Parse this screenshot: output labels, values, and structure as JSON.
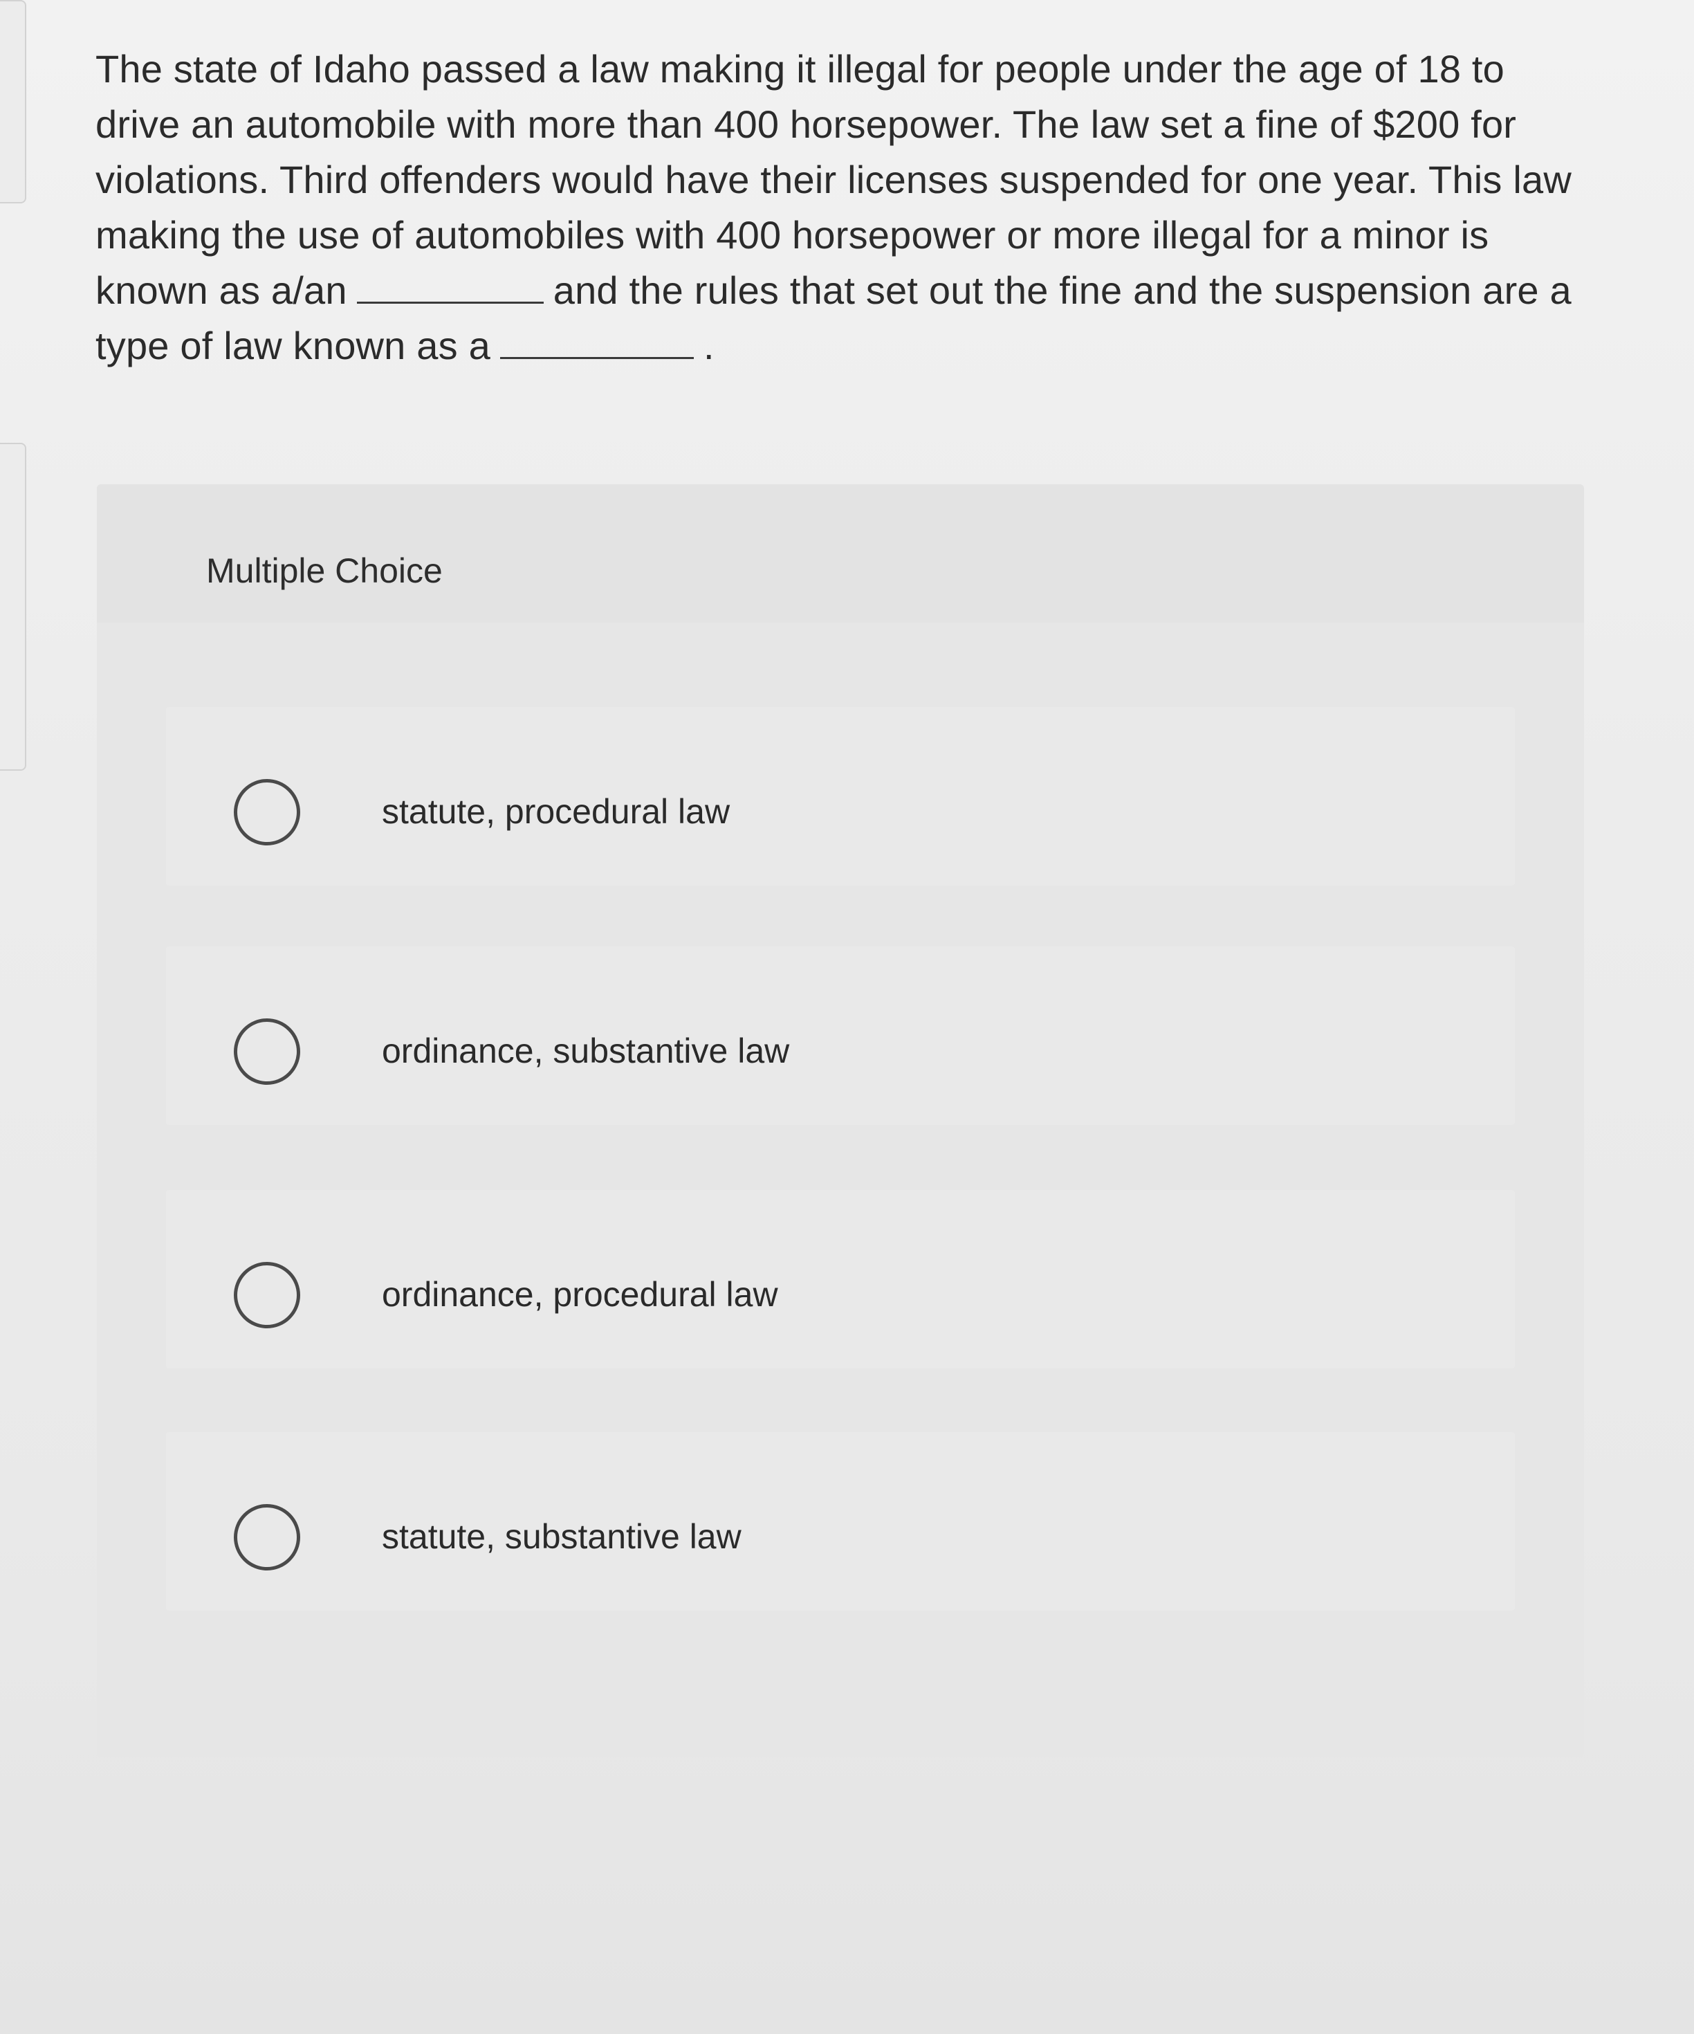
{
  "question": {
    "part1": "The state of Idaho passed a law making it illegal for people under the age of 18 to drive an automobile with more than 400 horsepower. The law set a fine of $200 for violations. Third offenders would have their licenses suspended for one year. This law making the use of automobiles with 400 horsepower or more illegal for a minor is known as a/an",
    "part2": "and the rules that set out the fine and the suspension are a type of law known as a",
    "part3": "."
  },
  "multiple_choice": {
    "title": "Multiple Choice",
    "options": [
      {
        "label": "statute, procedural law"
      },
      {
        "label": "ordinance, substantive law"
      },
      {
        "label": "ordinance, procedural law"
      },
      {
        "label": "statute, substantive law"
      }
    ]
  }
}
